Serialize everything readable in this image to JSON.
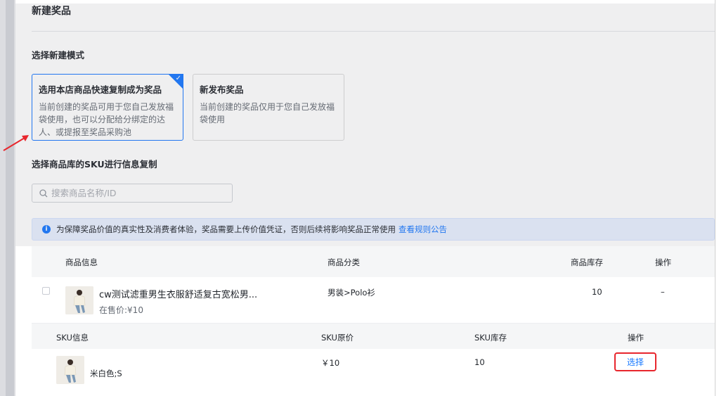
{
  "page": {
    "title": "新建奖品",
    "mode_section_label": "选择新建模式",
    "sku_section_label": "选择商品库的SKU进行信息复制"
  },
  "mode_cards": [
    {
      "title": "选用本店商品快速复制成为奖品",
      "desc": "当前创建的奖品可用于您自己发放福袋使用，也可以分配给分绑定的达人、或提报至奖品采购池",
      "selected": true,
      "check": "✓"
    },
    {
      "title": "新发布奖品",
      "desc": "当前创建的奖品仅用于您自己发放福袋使用",
      "selected": false
    }
  ],
  "search": {
    "placeholder": "搜索商品名称/ID",
    "value": "",
    "icon": "search-icon"
  },
  "notice": {
    "icon_text": "i",
    "text": "为保障奖品价值的真实性及消费者体验，奖品需要上传价值凭证，否则后续将影响奖品正常使用",
    "link": "查看规则公告"
  },
  "product_table": {
    "headers": {
      "info": "商品信息",
      "category": "商品分类",
      "stock": "商品库存",
      "action": "操作"
    },
    "row": {
      "name": "cw测试滤重男生衣服舒适复古宽松男...",
      "price": "在售价:¥10",
      "category": "男装>Polo衫",
      "stock": "10",
      "action": "–"
    }
  },
  "sku_table": {
    "headers": {
      "info": "SKU信息",
      "price": "SKU原价",
      "stock": "SKU库存",
      "action": "操作"
    },
    "row": {
      "name": "米白色;S",
      "price": "￥10",
      "stock": "10",
      "action_label": "选择"
    }
  },
  "colors": {
    "accent": "#1677ff",
    "highlight_border": "#e8262d",
    "arrow": "#e8262d"
  }
}
